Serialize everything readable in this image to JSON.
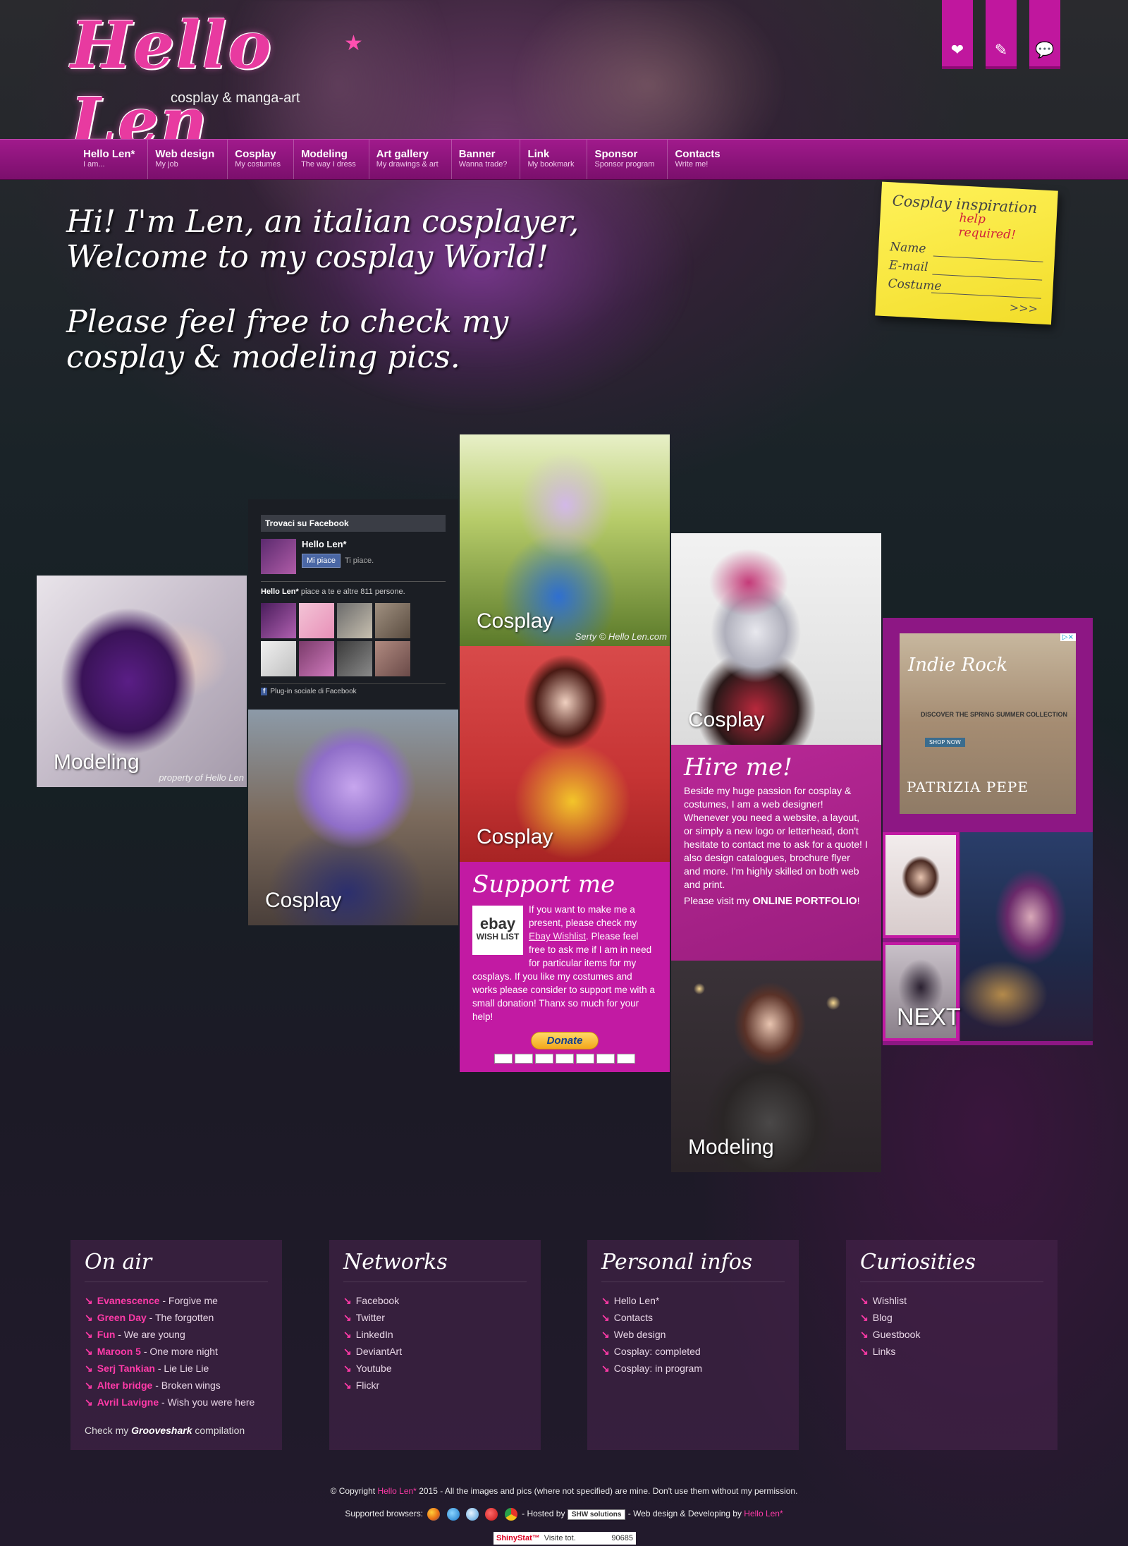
{
  "logo": {
    "title": "Hello Len",
    "star": "★",
    "subtitle": "cosplay & manga-art"
  },
  "top_tabs": [
    {
      "icon": "heart-icon",
      "glyph": "❤"
    },
    {
      "icon": "pencil-icon",
      "glyph": "✎"
    },
    {
      "icon": "speech-bubble-icon",
      "glyph": "💬"
    }
  ],
  "nav": [
    {
      "label": "Hello Len*",
      "sub": "I am..."
    },
    {
      "label": "Web design",
      "sub": "My job"
    },
    {
      "label": "Cosplay",
      "sub": "My costumes"
    },
    {
      "label": "Modeling",
      "sub": "The way I dress"
    },
    {
      "label": "Art gallery",
      "sub": "My drawings & art"
    },
    {
      "label": "Banner",
      "sub": "Wanna trade?"
    },
    {
      "label": "Link",
      "sub": "My bookmark"
    },
    {
      "label": "Sponsor",
      "sub": "Sponsor program"
    },
    {
      "label": "Contacts",
      "sub": "Write me!"
    }
  ],
  "intro": {
    "line1": "Hi! I'm Len, an italian cosplayer, Welcome to my cosplay World!",
    "line2": "Please feel free to check my cosplay & modeling pics."
  },
  "sticky": {
    "title": "Cosplay inspiration",
    "required": "help required!",
    "fields": [
      "Name",
      "E-mail",
      "Costume"
    ],
    "submit": ">>>"
  },
  "tiles": {
    "modeling1": {
      "caption": "Modeling",
      "watermark": "property of Hello Len"
    },
    "cosplay_purple": {
      "caption": "Cosplay"
    },
    "cosplay_blue": {
      "caption": "Cosplay",
      "watermark": "Serty © Hello Len.com"
    },
    "cosplay_red": {
      "caption": "Cosplay"
    },
    "cosplay_dark": {
      "caption": "Cosplay"
    },
    "modeling2": {
      "caption": "Modeling"
    },
    "next": {
      "caption": "NEXT"
    }
  },
  "facebook": {
    "header": "Trovaci su Facebook",
    "page_name": "Hello Len*",
    "like_button": "Mi piace",
    "you_like": "Ti piace.",
    "count_name": "Hello Len*",
    "count_text": "piace a te e altre 811 persone.",
    "footer": "Plug-in sociale di Facebook"
  },
  "hire": {
    "title": "Hire me!",
    "body": "Beside my huge passion for cosplay & costumes, I am a web designer! Whenever you need a website, a layout, or simply a new logo or letterhead, don't hesitate to contact me to ask for a quote! I also design catalogues, brochure flyer and more. I'm highly skilled on both web and print.",
    "cta_prefix": "Please visit my",
    "cta_link": "ONLINE PORTFOLIO",
    "cta_suffix": "!"
  },
  "support": {
    "title": "Support me",
    "badge_ebay": "ebay",
    "badge_text": "WISH LIST",
    "body_start": "If you want to make me a present, please check my",
    "link": "Ebay Wishlist",
    "body_end": ". Please feel free to ask me if I am in need for particular items for my cosplays. If you like my costumes and works please consider to support me with a small donation! Thanx so much for your help!",
    "donate": "Donate"
  },
  "ad": {
    "title": "Indie Rock",
    "text": "DISCOVER THE SPRING SUMMER COLLECTION",
    "button": "SHOP NOW",
    "brand": "PATRIZIA PEPE",
    "adchoice": "▷×"
  },
  "on_air": {
    "title": "On air",
    "songs": [
      {
        "artist": "Evanescence",
        "song": "Forgive me"
      },
      {
        "artist": "Green Day",
        "song": "The forgotten"
      },
      {
        "artist": "Fun",
        "song": "We are young"
      },
      {
        "artist": "Maroon 5",
        "song": "One more night"
      },
      {
        "artist": "Serj Tankian",
        "song": "Lie Lie Lie"
      },
      {
        "artist": "Alter bridge",
        "song": "Broken wings"
      },
      {
        "artist": "Avril Lavigne",
        "song": "Wish you were here"
      }
    ],
    "note_prefix": "Check my",
    "note_brand": "Grooveshark",
    "note_suffix": "compilation"
  },
  "networks": {
    "title": "Networks",
    "items": [
      "Facebook",
      "Twitter",
      "LinkedIn",
      "DeviantArt",
      "Youtube",
      "Flickr"
    ]
  },
  "personal": {
    "title": "Personal infos",
    "items": [
      "Hello Len*",
      "Contacts",
      "Web design",
      "Cosplay: completed",
      "Cosplay: in program"
    ]
  },
  "curiosities": {
    "title": "Curiosities",
    "items": [
      "Wishlist",
      "Blog",
      "Guestbook",
      "Links"
    ]
  },
  "footer": {
    "copyright_prefix": "© Copyright",
    "copyright_name": "Hello Len*",
    "copyright_rest": "2015 - All the images and pics (where not specified) are mine. Don't use them without my permission.",
    "browsers_label": "Supported browsers:",
    "hosted_by": "- Hosted by",
    "host": "SHW solutions",
    "design_by": "- Web design & Developing by",
    "designer": "Hello Len*"
  },
  "counter": {
    "brand": "ShinyStat™",
    "label": "Visite tot.",
    "value": "90685"
  }
}
